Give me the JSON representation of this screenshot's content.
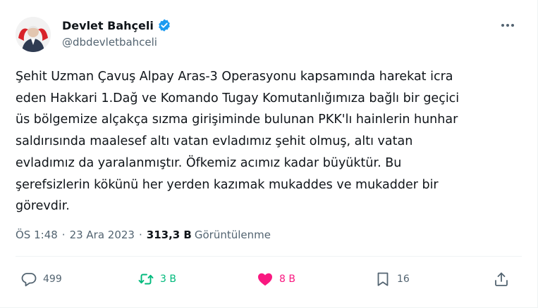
{
  "author": {
    "display_name": "Devlet Bahçeli",
    "handle": "@dbdevletbahceli",
    "verified": true,
    "avatar_icon": "avatar-icon"
  },
  "tweet": {
    "text": "Şehit Uzman Çavuş Alpay Aras-3 Operasyonu kapsamında harekat icra\neden Hakkari 1.Dağ ve Komando Tugay Komutanlığımıza bağlı bir geçici\nüs bölgemize alçakça sızma girişiminde bulunan PKK'lı hainlerin hunhar\nsaldırısında maalesef altı vatan evladımız şehit olmuş, altı vatan\nevladımız da yaralanmıştır. Öfkemiz acımız kadar büyüktür. Bu\nşerefsizlerin kökünü her yerden kazımak mukaddes ve mukadder bir\ngörevdir."
  },
  "meta": {
    "time": "ÖS 1:48",
    "separator": "·",
    "date": "23 Ara 2023",
    "views_count": "313,3 B",
    "views_label": "Görüntülenme"
  },
  "actions": {
    "reply_count": "499",
    "retweet_count": "3 B",
    "like_count": "8 B",
    "bookmark_count": "16"
  },
  "colors": {
    "verified": "#1d9bf0",
    "retweet": "#00ba7c",
    "like": "#f91880",
    "muted": "#536471",
    "text": "#0f1419"
  }
}
